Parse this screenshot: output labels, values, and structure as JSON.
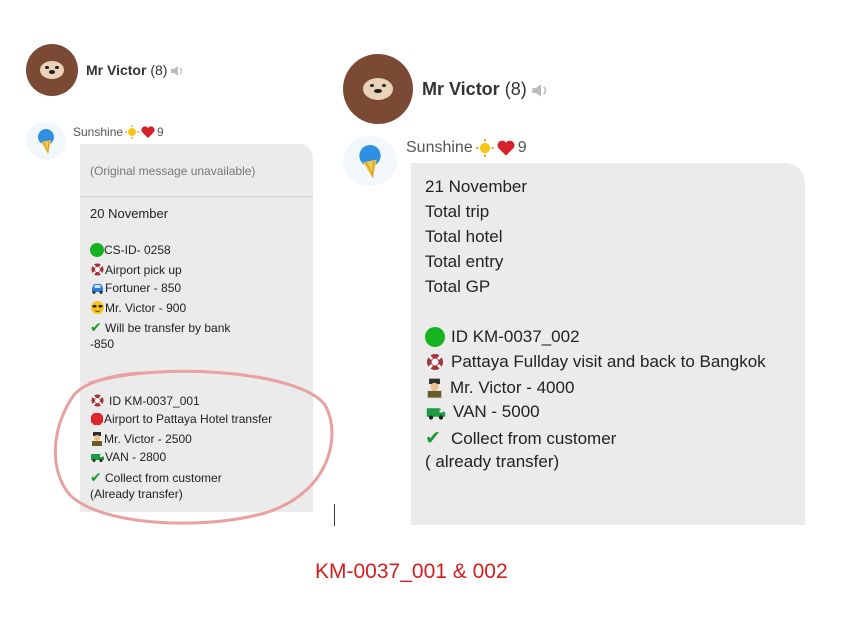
{
  "left_chat": {
    "header": {
      "name": "Mr Victor",
      "count": "(8)"
    },
    "sender": {
      "name": "Sunshine",
      "badge_count": "9"
    },
    "quoted": "(Original message unavailable)",
    "lines": [
      "20 November",
      "CS-ID- 0258",
      "Airport pick up",
      "Fortuner - 850",
      "Mr. Victor - 900",
      "Will be transfer by bank",
      "-850",
      "ID KM-0037_001",
      "Airport to Pattaya Hotel transfer",
      " Mr. Victor - 2500",
      " VAN - 2800",
      " Collect from customer",
      "(Already transfer)"
    ]
  },
  "right_chat": {
    "header": {
      "name": "Mr Victor",
      "count": "(8)"
    },
    "sender": {
      "name": "Sunshine",
      "badge_count": "9"
    },
    "lines": [
      "21 November",
      "Total trip",
      "Total hotel",
      "Total entry",
      "Total GP",
      "ID KM-0037_002",
      "Pattaya Fullday visit and back to Bangkok",
      " Mr. Victor - 4000",
      "VAN - 5000",
      "Collect from customer",
      "( already transfer)"
    ]
  },
  "caption": "KM-0037_001 & 002",
  "colors": {
    "highlight_circle": "#e8a0a0",
    "caption": "#d41e1e",
    "bubble": "#ebebeb"
  },
  "icons": [
    "bear-avatar",
    "speaker-icon",
    "sun-avatar",
    "sun-icon",
    "heart-icon",
    "green-circle-icon",
    "lifebuoy-icon",
    "car-icon",
    "sunglasses-face-icon",
    "check-icon",
    "octagon-icon",
    "officer-icon",
    "van-icon"
  ]
}
